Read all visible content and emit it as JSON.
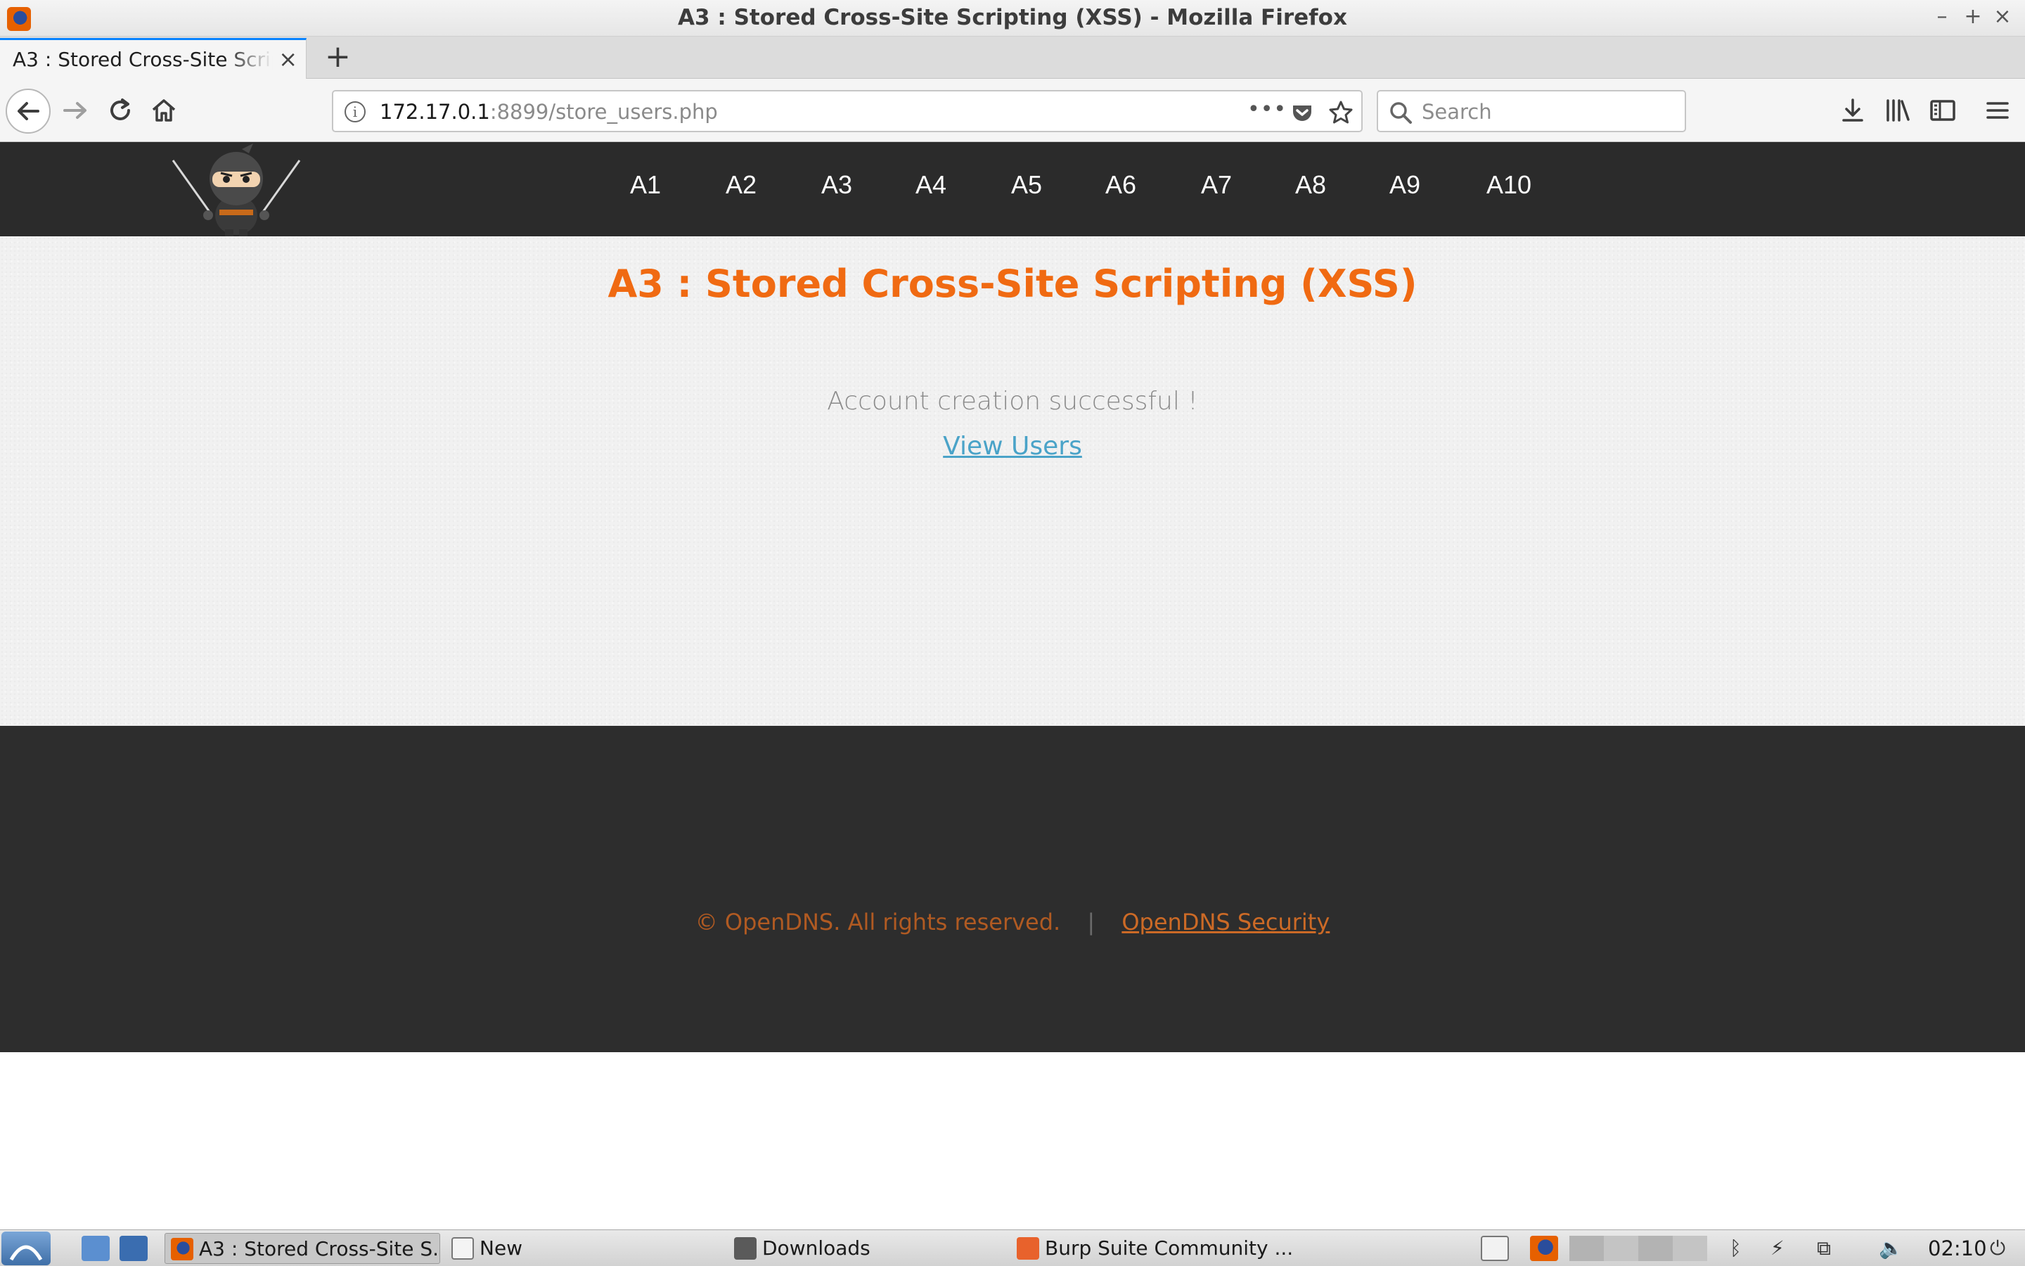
{
  "window": {
    "title": "A3 : Stored Cross-Site Scripting (XSS) - Mozilla Firefox",
    "minimize": "–",
    "maximize": "+",
    "close": "×"
  },
  "browser": {
    "tab": {
      "title": "A3 : Stored Cross-Site Scripting (XSS)",
      "close": "×"
    },
    "new_tab": "+",
    "url": {
      "host": "172.17.0.1",
      "rest": ":8899/store_users.php"
    },
    "search_placeholder": "Search",
    "page_actions": "•••"
  },
  "site": {
    "nav": [
      "A1",
      "A2",
      "A3",
      "A4",
      "A5",
      "A6",
      "A7",
      "A8",
      "A9",
      "A10"
    ],
    "heading": "A3 : Stored Cross-Site Scripting (XSS)",
    "message": "Account creation successful !",
    "view_users_link": "View Users",
    "footer": {
      "copyright": "© OpenDNS. All rights reserved.",
      "separator": "|",
      "link": "OpenDNS Security"
    },
    "colors": {
      "heading": "#f06a12",
      "link": "#4aa3c8",
      "header_bg": "#2b2b2b",
      "footer_text": "#b05a22"
    }
  },
  "taskbar": {
    "tasks": [
      {
        "label": "A3 : Stored Cross-Site S...",
        "icon": "firefox-icon",
        "active": true
      },
      {
        "label": "New",
        "icon": "text-editor-icon",
        "active": false
      },
      {
        "label": "Downloads",
        "icon": "folder-icon",
        "active": false
      },
      {
        "label": "Burp Suite Community ...",
        "icon": "burp-icon",
        "active": false
      }
    ],
    "clock": "02:10"
  }
}
